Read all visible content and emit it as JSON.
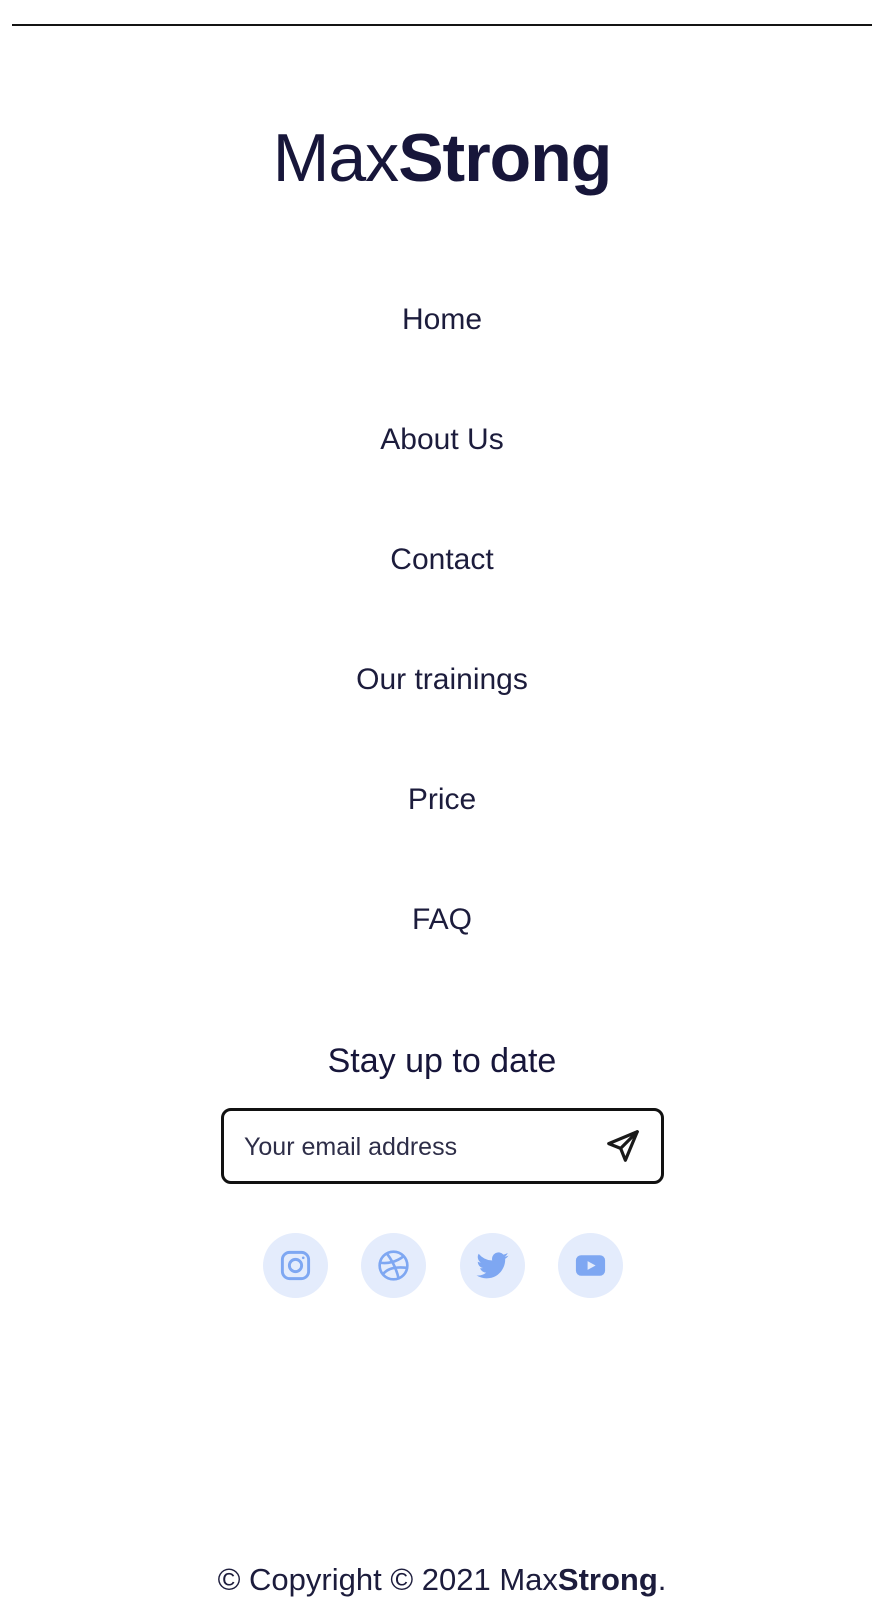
{
  "brand": {
    "light": "Max",
    "bold": "Strong"
  },
  "nav": {
    "home": "Home",
    "about": "About Us",
    "contact": "Contact",
    "trainings": "Our trainings",
    "price": "Price",
    "faq": "FAQ"
  },
  "newsletter": {
    "title": "Stay up to date",
    "placeholder": "Your email address",
    "send_icon": "send-icon"
  },
  "social": [
    {
      "icon": "instagram-icon"
    },
    {
      "icon": "dribbble-icon"
    },
    {
      "icon": "twitter-icon"
    },
    {
      "icon": "youtube-icon"
    }
  ],
  "footer": {
    "copyright_prefix": "© Copyright © 2021 Max",
    "copyright_bold": "Strong",
    "copyright_suffix": "."
  },
  "colors": {
    "text": "#17163a",
    "social_bg": "#e4ecfc",
    "social_icon": "#7ea7f2"
  }
}
